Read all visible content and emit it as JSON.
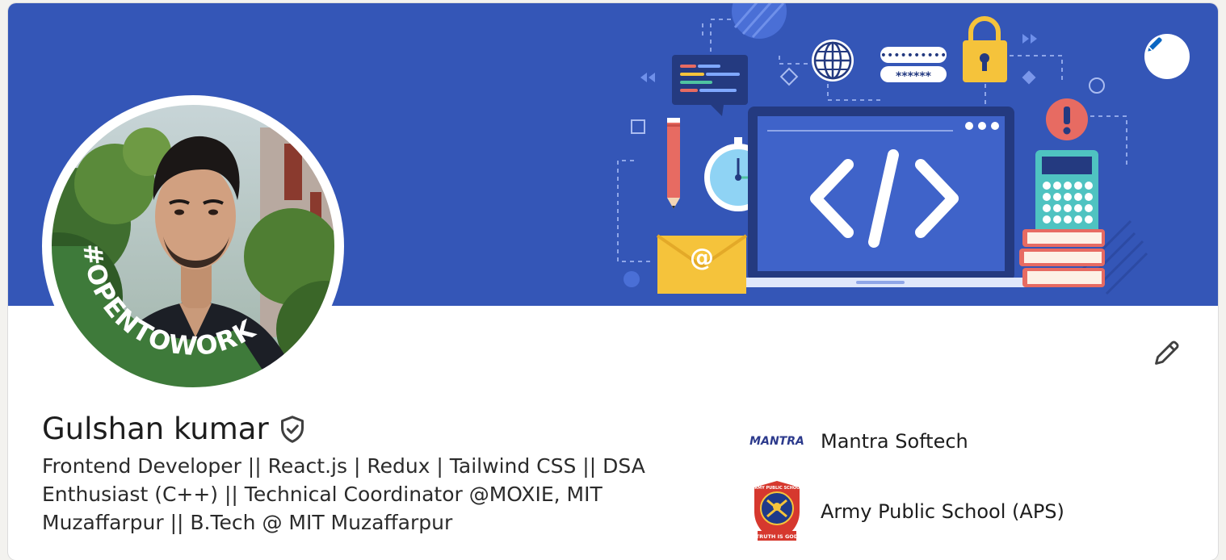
{
  "profile": {
    "name": "Gulshan kumar",
    "headline": "Frontend Developer || React.js | Redux | Tailwind CSS || DSA Enthusiast (C++) || Technical Coordinator @MOXIE, MIT Muzaffarpur || B.Tech @ MIT Muzaffarpur",
    "open_to_work_badge": "#OPENTOWORK",
    "verified_icon": "shield-check-icon"
  },
  "banner": {
    "code_symbol": "</>",
    "email_symbol": "@",
    "password_masks": [
      "••••••••••",
      "******"
    ]
  },
  "organizations": [
    {
      "name": "Mantra Softech",
      "logo_text": "MANTRA"
    },
    {
      "name": "Army Public School (APS)",
      "logo_text": "ARMY PUBLIC SCHOOL",
      "motto": "TRUTH IS GOD"
    }
  ],
  "colors": {
    "banner_bg": "#3456b7",
    "open_to_work_green": "#3e7a3a",
    "text_primary": "#1d1d1d"
  }
}
